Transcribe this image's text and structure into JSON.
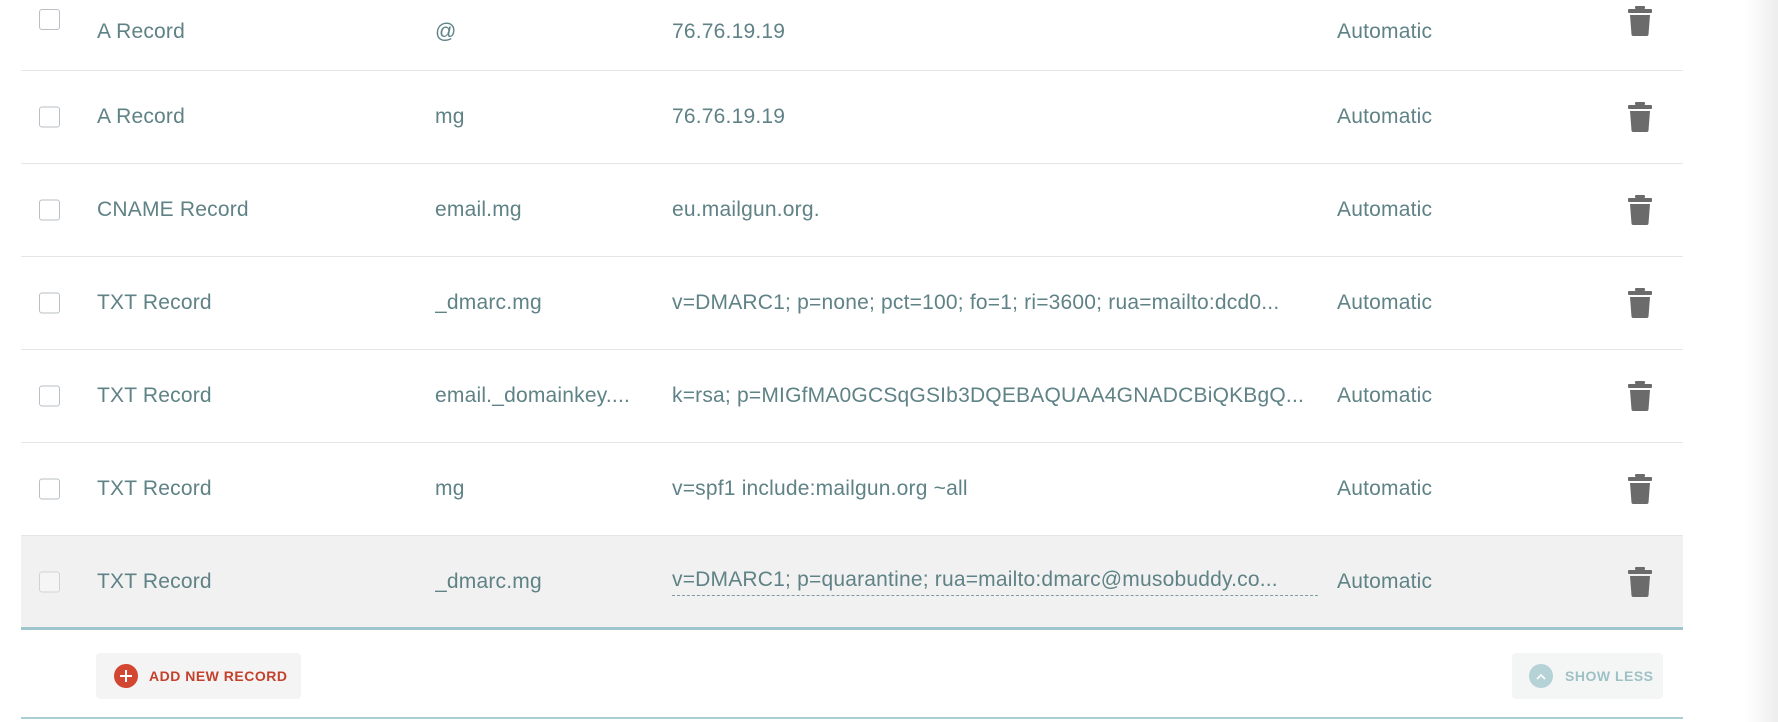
{
  "records": [
    {
      "type": "A Record",
      "host": "@",
      "value": "76.76.19.19",
      "ttl": "Automatic"
    },
    {
      "type": "A Record",
      "host": "mg",
      "value": "76.76.19.19",
      "ttl": "Automatic"
    },
    {
      "type": "CNAME Record",
      "host": "email.mg",
      "value": "eu.mailgun.org.",
      "ttl": "Automatic"
    },
    {
      "type": "TXT Record",
      "host": "_dmarc.mg",
      "value": "v=DMARC1; p=none; pct=100; fo=1; ri=3600; rua=mailto:dcd0...",
      "ttl": "Automatic"
    },
    {
      "type": "TXT Record",
      "host": "email._domainkey....",
      "value": "k=rsa; p=MIGfMA0GCSqGSIb3DQEBAQUAA4GNADCBiQKBgQ...",
      "ttl": "Automatic"
    },
    {
      "type": "TXT Record",
      "host": "mg",
      "value": "v=spf1 include:mailgun.org ~all",
      "ttl": "Automatic"
    },
    {
      "type": "TXT Record",
      "host": "_dmarc.mg",
      "value": "v=DMARC1; p=quarantine; rua=mailto:dmarc@musobuddy.co...",
      "ttl": "Automatic"
    }
  ],
  "footer": {
    "add_label": "ADD NEW RECORD",
    "show_less_label": "SHOW LESS"
  },
  "icons": {
    "row_action": "trash-icon",
    "add": "plus-circle-icon",
    "show_less": "chevron-up-icon"
  },
  "colors": {
    "text": "#5f8286",
    "accent_red": "#d24632",
    "accent_teal": "#9ec6cc",
    "trash": "#6b6b6b"
  }
}
